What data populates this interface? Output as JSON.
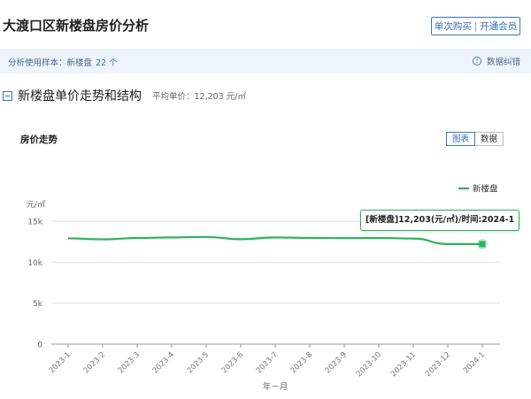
{
  "header": {
    "title": "大渡口区新楼盘房价分析",
    "buy_label": "单次购买",
    "separator": "|",
    "member_label": "开通会员"
  },
  "sample_bar": {
    "text": "分析使用样本：新楼盘",
    "count": "22 个",
    "feedback_label": "数据纠错",
    "feedback_icon": "info-circle-icon"
  },
  "section": {
    "title": "新楼盘单价走势和结构",
    "avg_label": "平均单价：",
    "avg_value": "12,203 元/㎡",
    "collapse_icon": "minus-square-icon"
  },
  "chart_panel": {
    "title": "房价走势",
    "tabs": [
      {
        "label": "图表",
        "active": true
      },
      {
        "label": "数据",
        "active": false
      }
    ]
  },
  "tooltip": {
    "text": "[新楼盘]12,203(元/㎡)/时间:2024-1"
  },
  "chart_data": {
    "type": "line",
    "categories": [
      "2023-1",
      "2023-2",
      "2023-3",
      "2023-4",
      "2023-5",
      "2023-6",
      "2023-7",
      "2023-8",
      "2023-9",
      "2023-10",
      "2023-11",
      "2023-12",
      "2024-1"
    ],
    "series": [
      {
        "name": "新楼盘",
        "color": "#2db35d",
        "values": [
          12900,
          12780,
          12950,
          13020,
          13080,
          12800,
          13020,
          12960,
          12930,
          12950,
          12880,
          12210,
          12203
        ]
      }
    ],
    "ylabel": "元/㎡",
    "xlabel": "年－月",
    "yticks": [
      0,
      5000,
      10000,
      15000
    ],
    "ytick_labels": [
      "0",
      "5k",
      "10k",
      "15k"
    ],
    "ylim": [
      0,
      15000
    ],
    "grid": true,
    "legend_position": "top-right"
  }
}
